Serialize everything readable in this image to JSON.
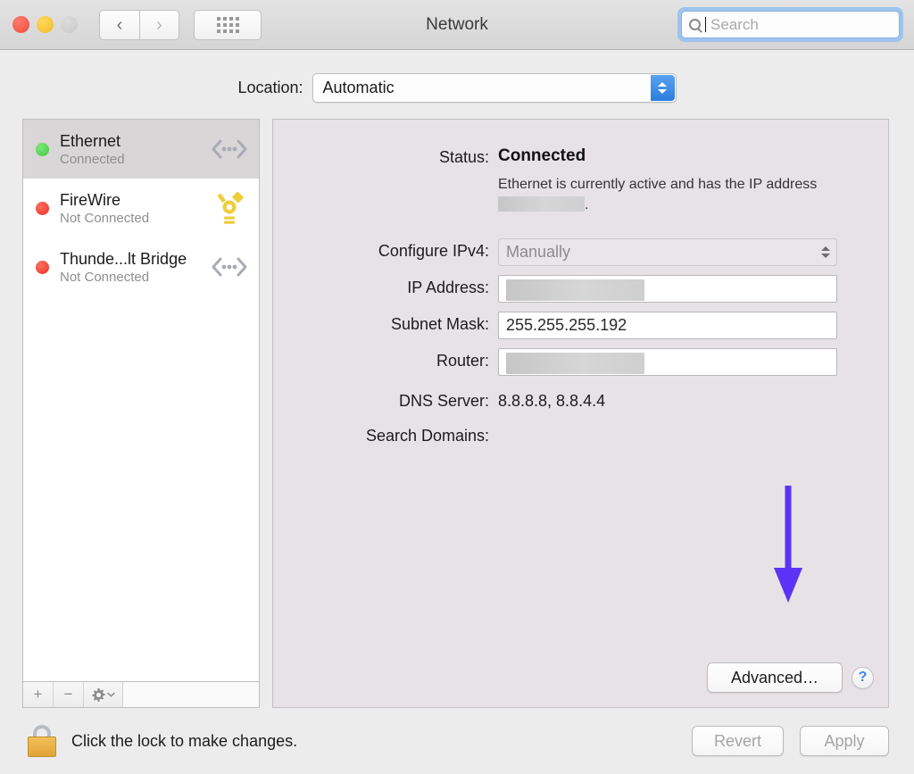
{
  "window": {
    "title": "Network"
  },
  "toolbar": {
    "close_label": "close",
    "minimize_label": "minimize",
    "zoom_label": "zoom",
    "back_glyph": "‹",
    "forward_glyph": "›",
    "show_all_label": "Show All",
    "search": {
      "placeholder": "Search",
      "value": ""
    }
  },
  "location": {
    "label": "Location:",
    "value": "Automatic"
  },
  "sidebar": {
    "services": [
      {
        "name": "Ethernet",
        "status": "Connected",
        "dot": "green",
        "icon": "network-bridge-icon"
      },
      {
        "name": "FireWire",
        "status": "Not Connected",
        "dot": "red",
        "icon": "firewire-icon"
      },
      {
        "name": "Thunde...lt Bridge",
        "status": "Not Connected",
        "dot": "red",
        "icon": "network-bridge-icon"
      }
    ],
    "footer": {
      "add_label": "+",
      "remove_label": "−",
      "actions_label": "gear"
    }
  },
  "main": {
    "status": {
      "label": "Status:",
      "value": "Connected",
      "description_before": "Ethernet is currently active and has the IP address",
      "description_after": "."
    },
    "fields": [
      {
        "label": "Configure IPv4:",
        "value": "Manually",
        "type": "popup-disabled"
      },
      {
        "label": "IP Address:",
        "value": "",
        "type": "text-redacted"
      },
      {
        "label": "Subnet Mask:",
        "value": "255.255.255.192",
        "type": "text"
      },
      {
        "label": "Router:",
        "value": "",
        "type": "text-redacted"
      },
      {
        "label": "DNS Server:",
        "value": "8.8.8.8, 8.8.4.4",
        "type": "plain"
      },
      {
        "label": "Search Domains:",
        "value": "",
        "type": "plain"
      }
    ],
    "advanced_label": "Advanced…",
    "help_label": "?"
  },
  "bottom": {
    "lock_text": "Click the lock to make changes.",
    "revert_label": "Revert",
    "apply_label": "Apply"
  },
  "annotation": {
    "arrow_color": "#5c33f6",
    "points_to": "Advanced…"
  },
  "colors": {
    "panel_bg": "#e7e2e6",
    "window_bg": "#ececec",
    "titlebar_bg": "#dcdbdb",
    "selection": "#d8d6d6",
    "connected_dot": "#3ec73b",
    "disconnected_dot": "#ef2f22",
    "firewire_icon": "#eecd3c",
    "stepper_blue": "#2b7de0",
    "help_blue": "#3c88e8",
    "lock_gold": "#e0a437"
  }
}
